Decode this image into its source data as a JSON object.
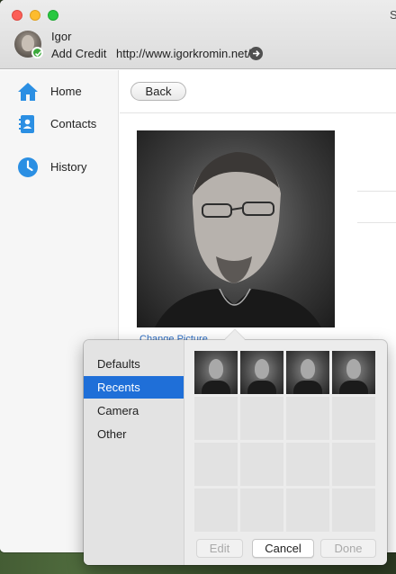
{
  "window": {
    "title_cut": "S"
  },
  "user": {
    "name": "Igor",
    "add_credit": "Add Credit",
    "website": "http://www.igorkromin.net/"
  },
  "sidebar": {
    "items": [
      {
        "label": "Home",
        "icon": "home-icon"
      },
      {
        "label": "Contacts",
        "icon": "contacts-icon"
      },
      {
        "label": "History",
        "icon": "clock-icon"
      }
    ]
  },
  "content": {
    "back_label": "Back",
    "change_picture": "Change Picture..."
  },
  "picker": {
    "sources": [
      {
        "label": "Defaults",
        "selected": false
      },
      {
        "label": "Recents",
        "selected": true
      },
      {
        "label": "Camera",
        "selected": false
      },
      {
        "label": "Other",
        "selected": false
      }
    ],
    "buttons": {
      "edit": "Edit",
      "cancel": "Cancel",
      "done": "Done"
    },
    "recent_thumbnails": 4
  },
  "colors": {
    "accent": "#1f6fd8",
    "nav_icon": "#2b8fe3",
    "status_green": "#3aa93a"
  }
}
